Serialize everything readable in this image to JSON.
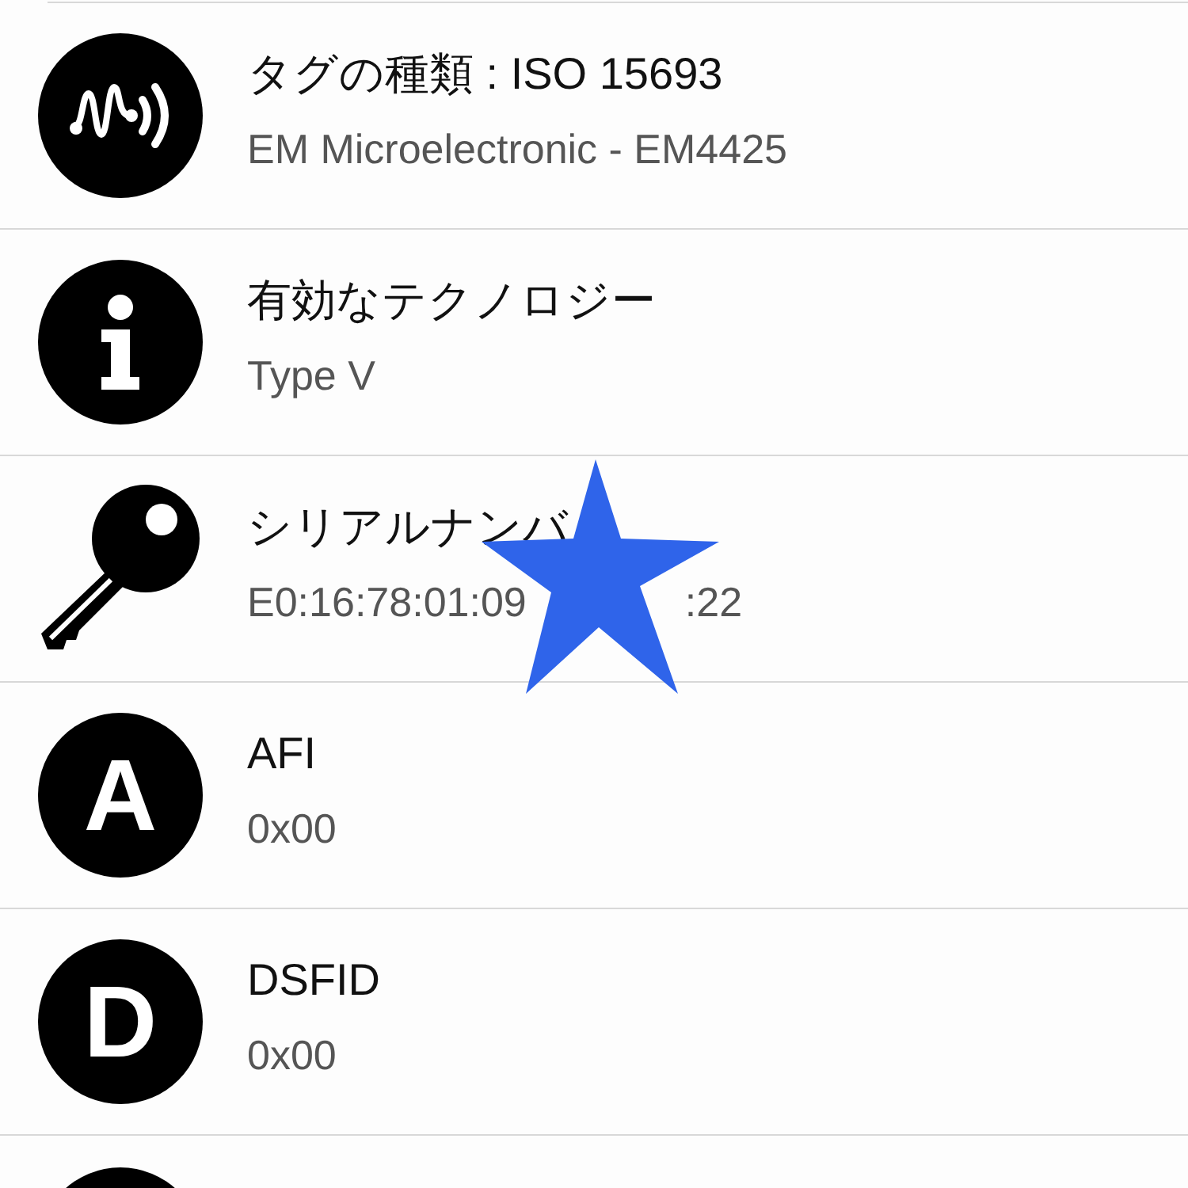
{
  "rows": [
    {
      "kind": "nfc",
      "title": "タグの種類 : ISO 15693",
      "value": [
        "EM Microelectronic - EM4425"
      ]
    },
    {
      "kind": "info",
      "title": "有効なテクノロジー",
      "value": [
        "Type V"
      ]
    },
    {
      "kind": "key",
      "title": "シリアルナンバ",
      "value": [
        "E0:16:78:01:09",
        ":22"
      ],
      "covered": true
    },
    {
      "kind": "letter",
      "letter": "A",
      "title": "AFI",
      "value": [
        "0x00"
      ]
    },
    {
      "kind": "letter",
      "letter": "D",
      "title": "DSFID",
      "value": [
        "0x00"
      ]
    },
    {
      "kind": "blank"
    }
  ]
}
